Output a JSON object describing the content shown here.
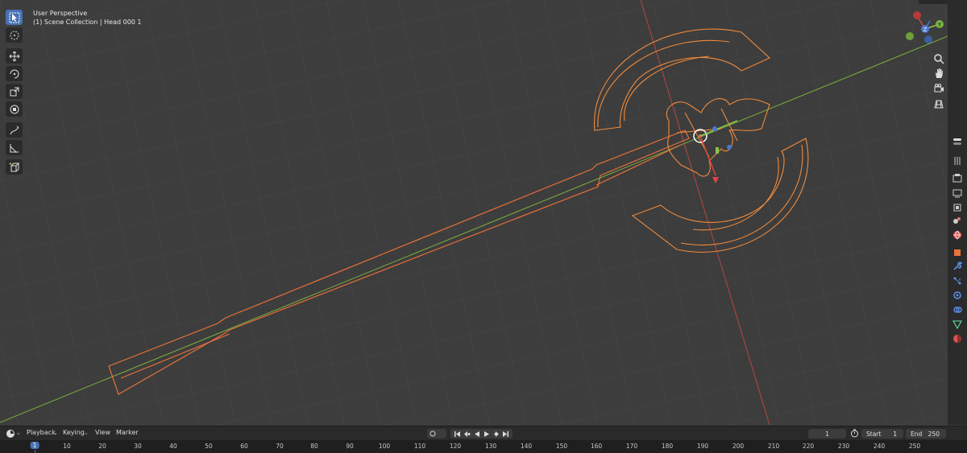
{
  "viewport": {
    "title": "User Perspective",
    "collection": "(1) Scene Collection | Head 000 1"
  },
  "toolbar": {
    "tools": [
      "select-box",
      "cursor",
      "move",
      "rotate",
      "scale",
      "transform",
      "annotate",
      "measure",
      "add-cube"
    ],
    "active_tool": "select-box"
  },
  "gizmo": {
    "axis_y": "Y",
    "axis_z": "Z"
  },
  "nav_tools": [
    "zoom-icon",
    "hand-icon",
    "camera-icon",
    "grid-icon"
  ],
  "right_panel": [
    "tool",
    "render",
    "output",
    "view-layer",
    "scene",
    "world",
    "object",
    "modifier",
    "particles",
    "physics",
    "constraints",
    "data",
    "material"
  ],
  "timeline": {
    "menus": [
      "Playback",
      "Keying",
      "View",
      "Marker"
    ],
    "current_frame": "1",
    "start_label": "Start",
    "start_value": "1",
    "end_label": "End",
    "end_value": "250",
    "ruler": [
      "1",
      "10",
      "20",
      "30",
      "40",
      "50",
      "60",
      "70",
      "80",
      "90",
      "100",
      "110",
      "120",
      "130",
      "140",
      "150",
      "160",
      "170",
      "180",
      "190",
      "200",
      "210",
      "220",
      "230",
      "240",
      "250"
    ]
  },
  "colors": {
    "accent": "#4772b3",
    "selection_outline": "#e8733a",
    "x_axis": "#c74a4a",
    "y_axis": "#7cb342"
  }
}
